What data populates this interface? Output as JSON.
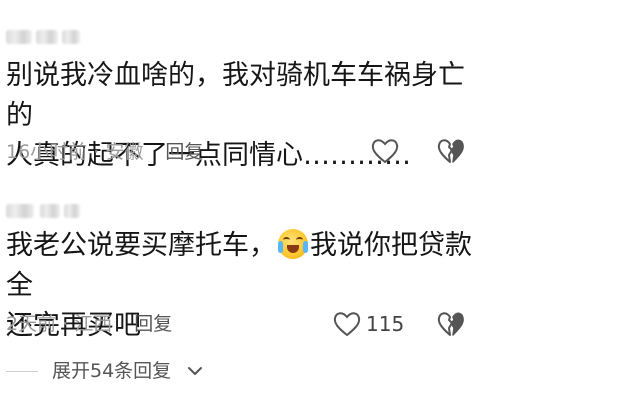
{
  "comments": [
    {
      "text": "别说我冷血啥的，我对骑机车车祸身亡的\n人真的起不了一点同情心…………",
      "time": "16小时前",
      "location": "安徽",
      "reply_label": "回复",
      "like_count": ""
    },
    {
      "text_before": "我老公说要买摩托车，",
      "text_after": "我说你把贷款全\n还完再买吧",
      "emoji": "loudly-crying-face",
      "time": "2天前",
      "location": "江西",
      "reply_label": "回复",
      "like_count": "115"
    }
  ],
  "expand": {
    "label": "展开54条回复"
  },
  "colors": {
    "meta": "#9a9a9a",
    "text": "#161616",
    "icon": "#555555"
  }
}
